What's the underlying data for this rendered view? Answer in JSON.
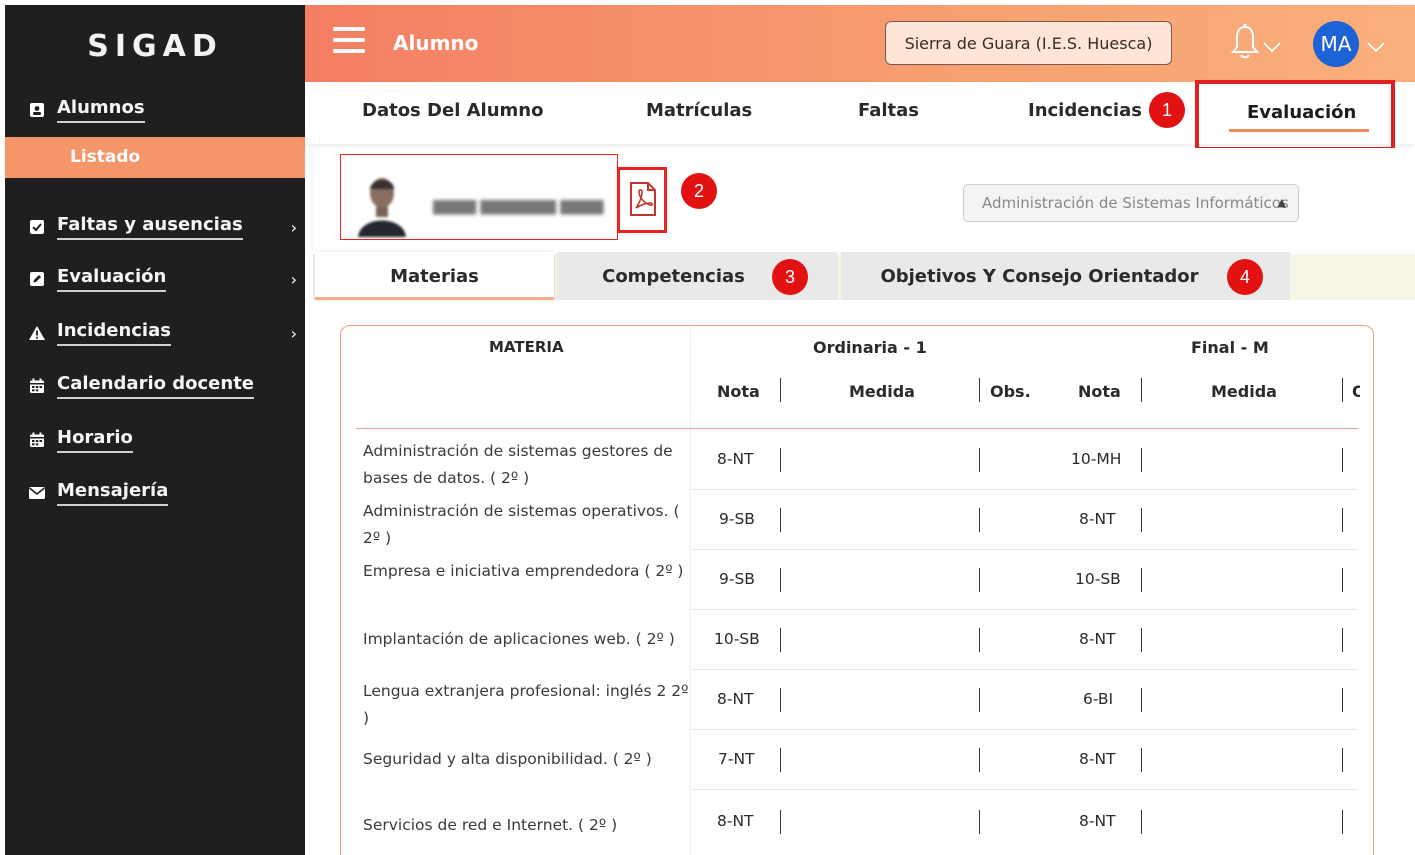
{
  "app": {
    "name": "SIGAD",
    "section_title": "Alumno"
  },
  "colors": {
    "accent": "#f5956a",
    "sidebar_bg": "#1f1f22",
    "badge_red": "#e31212",
    "avatar_blue": "#1e63d6"
  },
  "sidebar": {
    "items": [
      {
        "label": "Alumnos",
        "icon": "student-card-icon",
        "has_chevron": false
      },
      {
        "label": "Faltas y ausencias",
        "icon": "checkbox-icon",
        "has_chevron": true
      },
      {
        "label": "Evaluación",
        "icon": "edit-icon",
        "has_chevron": true
      },
      {
        "label": "Incidencias",
        "icon": "warning-icon",
        "has_chevron": true
      },
      {
        "label": "Calendario docente",
        "icon": "calendar-icon",
        "has_chevron": false
      },
      {
        "label": "Horario",
        "icon": "calendar-icon",
        "has_chevron": false
      },
      {
        "label": "Mensajería",
        "icon": "envelope-icon",
        "has_chevron": false
      }
    ],
    "subitem_active": "Listado"
  },
  "header": {
    "center_label": "Sierra de Guara (I.E.S. Huesca)",
    "avatar_initials": "MA"
  },
  "tabs": [
    "Datos Del Alumno",
    "Matrículas",
    "Faltas",
    "Incidencias",
    "Evaluación"
  ],
  "active_tab": "Evaluación",
  "badges": [
    "1",
    "2",
    "3",
    "4"
  ],
  "student": {
    "ciclo_select": "Administración de Sistemas Informáticos"
  },
  "subtabs": [
    "Materias",
    "Competencias",
    "Objetivos Y Consejo Orientador"
  ],
  "table": {
    "header_materia": "MATERIA",
    "group_ordinaria": "Ordinaria - 1",
    "group_final": "Final - M",
    "subheaders": {
      "nota": "Nota",
      "medida": "Medida",
      "obs": "Obs."
    },
    "rows": [
      {
        "materia": "Administración de sistemas gestores de bases de datos. ( 2º )",
        "ord_nota": "8-NT",
        "fin_nota": "10-MH"
      },
      {
        "materia": "Administración de sistemas operativos. ( 2º )",
        "ord_nota": "9-SB",
        "fin_nota": "8-NT"
      },
      {
        "materia": "Empresa e iniciativa emprendedora ( 2º )",
        "ord_nota": "9-SB",
        "fin_nota": "10-SB"
      },
      {
        "materia": "Implantación de aplicaciones web. ( 2º )",
        "ord_nota": "10-SB",
        "fin_nota": "8-NT"
      },
      {
        "materia": "Lengua extranjera profesional: inglés 2 2º )",
        "ord_nota": "8-NT",
        "fin_nota": "6-BI"
      },
      {
        "materia": "Seguridad y alta disponibilidad. ( 2º )",
        "ord_nota": "7-NT",
        "fin_nota": "8-NT"
      },
      {
        "materia": "Servicios de red e Internet. ( 2º )",
        "ord_nota": "8-NT",
        "fin_nota": "8-NT"
      }
    ]
  }
}
